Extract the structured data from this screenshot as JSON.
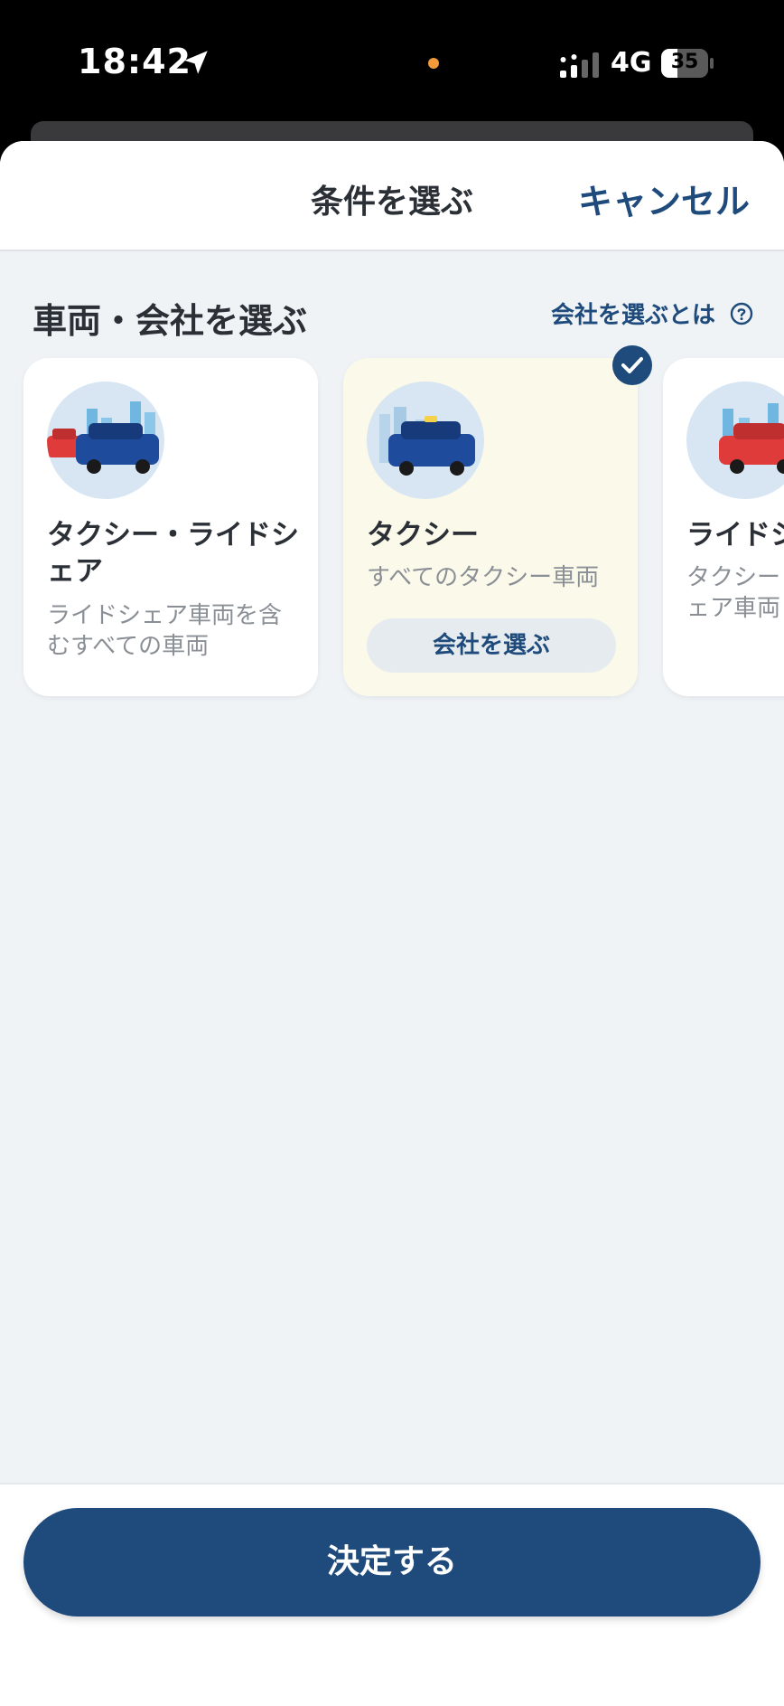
{
  "status_bar": {
    "time": "18:42",
    "network": "4G",
    "battery": "35",
    "battery_level": 0.35,
    "location_icon": "location-arrow-icon",
    "signal_icon": "signal-bars-icon"
  },
  "sheet": {
    "title": "条件を選ぶ",
    "cancel_label": "キャンセル"
  },
  "section": {
    "title": "車両・会社を選ぶ",
    "about_link": "会社を選ぶとは",
    "about_icon": "question-circle-icon"
  },
  "cards": [
    {
      "name": "タクシー・ライドシェア",
      "description": "ライドシェア車両を含むすべての車両",
      "selected": false,
      "icon": "taxi-and-car-illustration"
    },
    {
      "name": "タクシー",
      "description": "すべてのタクシー車両",
      "button": "会社を選ぶ",
      "selected": true,
      "icon": "taxi-illustration"
    },
    {
      "name": "ライドシ",
      "description": "タクシー・シェア車両",
      "selected": false,
      "icon": "rideshare-car-illustration"
    }
  ],
  "footer": {
    "confirm_label": "決定する"
  },
  "colors": {
    "primary": "#1f4b7c",
    "selected_card_bg": "#fbf9ea",
    "sheet_bg": "#eff3f6"
  }
}
